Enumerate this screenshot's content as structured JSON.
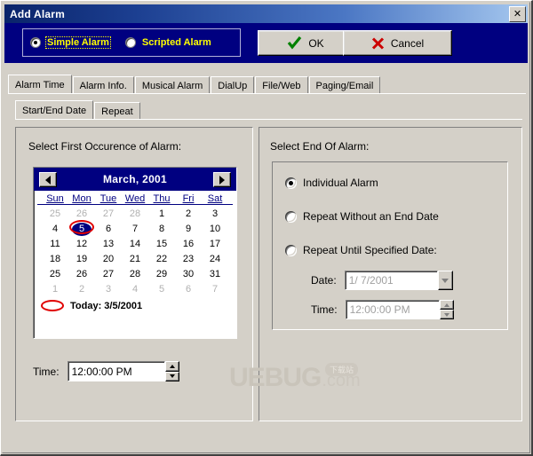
{
  "window": {
    "title": "Add Alarm",
    "close_label": "✕"
  },
  "alarm_type": {
    "options": [
      {
        "label": "Simple Alarm",
        "selected": true,
        "focused": true
      },
      {
        "label": "Scripted Alarm",
        "selected": false,
        "focused": false
      }
    ]
  },
  "actions": {
    "ok_label": "OK",
    "ok_icon": "check-icon",
    "cancel_label": "Cancel",
    "cancel_icon": "cross-icon"
  },
  "tabs_primary": {
    "items": [
      {
        "label": "Alarm Time",
        "active": true
      },
      {
        "label": "Alarm Info.",
        "active": false
      },
      {
        "label": "Musical Alarm",
        "active": false
      },
      {
        "label": "DialUp",
        "active": false
      },
      {
        "label": "File/Web",
        "active": false
      },
      {
        "label": "Paging/Email",
        "active": false
      }
    ]
  },
  "tabs_secondary": {
    "items": [
      {
        "label": "Start/End Date",
        "active": true
      },
      {
        "label": "Repeat",
        "active": false
      }
    ]
  },
  "left_panel": {
    "title": "Select First Occurence of Alarm:",
    "calendar": {
      "prev_label": "◀",
      "next_label": "▶",
      "month_title": "March, 2001",
      "day_headers": [
        "Sun",
        "Mon",
        "Tue",
        "Wed",
        "Thu",
        "Fri",
        "Sat"
      ],
      "weeks": [
        [
          {
            "d": "25",
            "out": true
          },
          {
            "d": "26",
            "out": true
          },
          {
            "d": "27",
            "out": true
          },
          {
            "d": "28",
            "out": true
          },
          {
            "d": "1"
          },
          {
            "d": "2"
          },
          {
            "d": "3"
          }
        ],
        [
          {
            "d": "4"
          },
          {
            "d": "5",
            "selected": true,
            "today": true
          },
          {
            "d": "6"
          },
          {
            "d": "7"
          },
          {
            "d": "8"
          },
          {
            "d": "9"
          },
          {
            "d": "10"
          }
        ],
        [
          {
            "d": "11"
          },
          {
            "d": "12"
          },
          {
            "d": "13"
          },
          {
            "d": "14"
          },
          {
            "d": "15"
          },
          {
            "d": "16"
          },
          {
            "d": "17"
          }
        ],
        [
          {
            "d": "18"
          },
          {
            "d": "19"
          },
          {
            "d": "20"
          },
          {
            "d": "21"
          },
          {
            "d": "22"
          },
          {
            "d": "23"
          },
          {
            "d": "24"
          }
        ],
        [
          {
            "d": "25"
          },
          {
            "d": "26"
          },
          {
            "d": "27"
          },
          {
            "d": "28"
          },
          {
            "d": "29"
          },
          {
            "d": "30"
          },
          {
            "d": "31"
          }
        ],
        [
          {
            "d": "1",
            "out": true
          },
          {
            "d": "2",
            "out": true
          },
          {
            "d": "3",
            "out": true
          },
          {
            "d": "4",
            "out": true
          },
          {
            "d": "5",
            "out": true
          },
          {
            "d": "6",
            "out": true
          },
          {
            "d": "7",
            "out": true
          }
        ]
      ],
      "today_text": "Today: 3/5/2001"
    },
    "time_label": "Time:",
    "time_value": "12:00:00 PM"
  },
  "right_panel": {
    "title": "Select End Of Alarm:",
    "options": [
      {
        "label": "Individual Alarm",
        "selected": true
      },
      {
        "label": "Repeat Without an End Date",
        "selected": false
      },
      {
        "label": "Repeat Until Specified Date:",
        "selected": false
      }
    ],
    "date_label": "Date:",
    "date_value": "1/ 7/2001",
    "time_label": "Time:",
    "time_value": "12:00:00 PM"
  },
  "watermark": {
    "main": "UEBUG",
    "dotcom": ".com",
    "badge": "下载站"
  }
}
